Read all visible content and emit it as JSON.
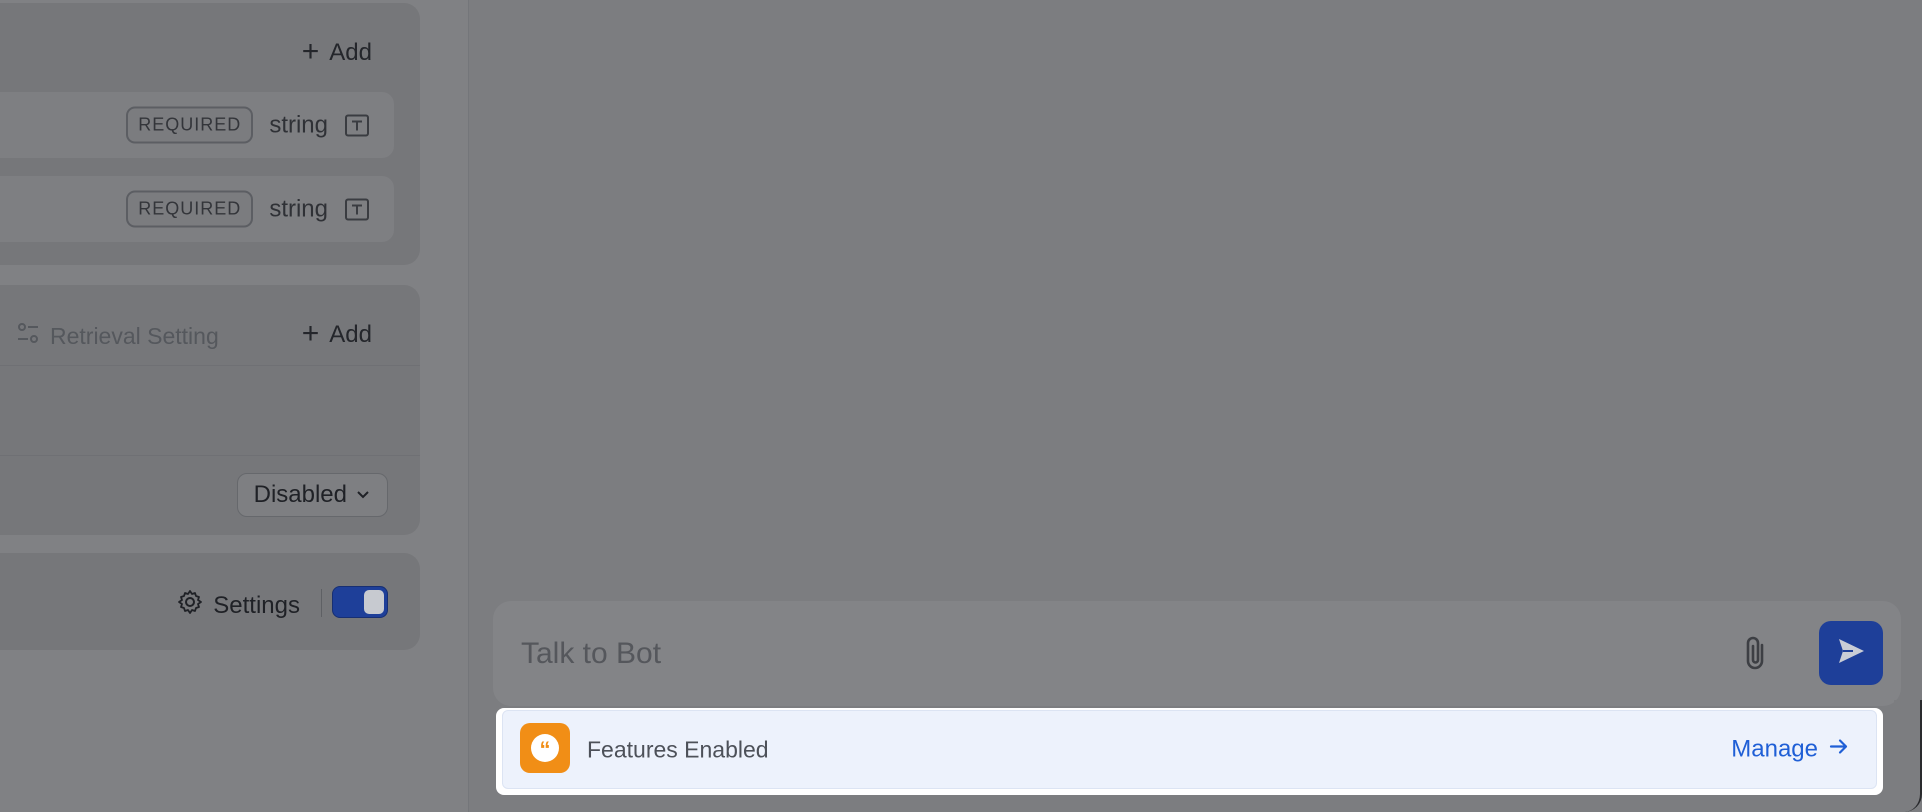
{
  "left_panel": {
    "variables": {
      "add_label": "Add",
      "rows": [
        {
          "badge": "REQUIRED",
          "type": "string"
        },
        {
          "badge": "REQUIRED",
          "type": "string"
        }
      ]
    },
    "context": {
      "retrieval_label": "Retrieval Setting",
      "add_label": "Add",
      "dropdown_value": "Disabled"
    },
    "feature": {
      "settings_label": "Settings",
      "toggle_on": true
    }
  },
  "chat": {
    "placeholder": "Talk to Bot"
  },
  "features_bar": {
    "label": "Features Enabled",
    "manage_label": "Manage",
    "icon_color": "#F18E16",
    "link_color": "#1F5FD6"
  },
  "colors": {
    "primary": "#1E3F99"
  }
}
